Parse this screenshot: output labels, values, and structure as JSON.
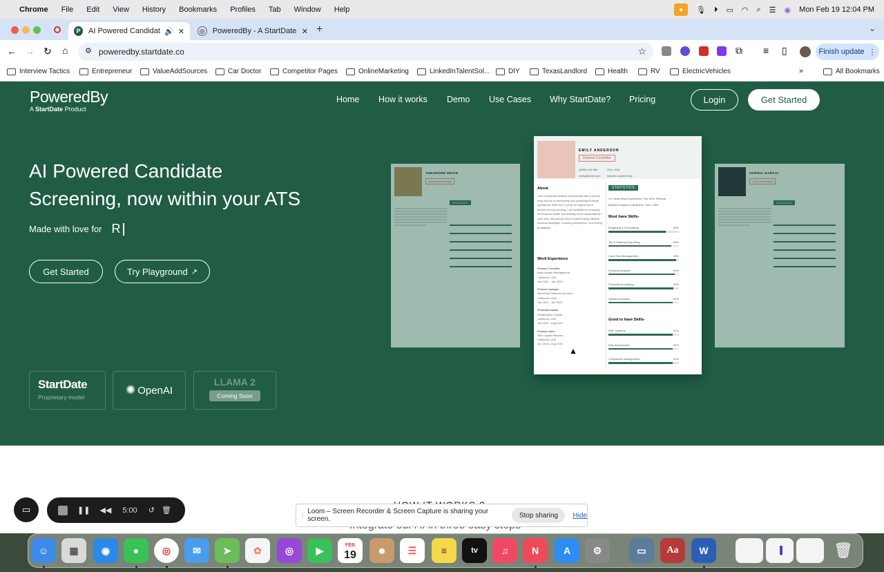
{
  "menubar": {
    "app": "Chrome",
    "items": [
      "File",
      "Edit",
      "View",
      "History",
      "Bookmarks",
      "Profiles",
      "Tab",
      "Window",
      "Help"
    ],
    "clock": "Mon Feb 19  12:04 PM"
  },
  "tabs": [
    {
      "title": "AI Powered Candidate Sc",
      "active": true
    },
    {
      "title": "PoweredBy - A StartDate Pro",
      "active": false
    }
  ],
  "toolbar": {
    "url": "poweredby.startdate.co",
    "finish_update": "Finish update"
  },
  "bookmarks": [
    "Interview Tactics",
    "Entrepreneur",
    "ValueAddSources",
    "Car Doctor",
    "Competitor Pages",
    "OnlineMarketing",
    "LinkedInTalentSol...",
    "DIY",
    "TexasLandlord",
    "Health",
    "RV",
    "ElectricVehicles"
  ],
  "all_bookmarks": "All Bookmarks",
  "site": {
    "logo": "PoweredBy",
    "logo_sub_prefix": "A",
    "logo_sub_brand": "StartDate",
    "logo_sub_suffix": "Product",
    "nav": [
      "Home",
      "How it works",
      "Demo",
      "Use Cases",
      "Why StartDate?",
      "Pricing"
    ],
    "login": "Login",
    "get_started_nav": "Get Started",
    "headline_1": "AI Powered Candidate",
    "headline_2": "Screening, now within your ATS",
    "tagline": "Made with love for",
    "typing": "R",
    "cta_primary": "Get Started",
    "cta_secondary": "Try Playground",
    "logos": {
      "startdate": "StartDate",
      "startdate_sub": "Proprietary model",
      "openai": "OpenAI",
      "llama": "LLAMA 2",
      "coming_soon": "Coming Soon"
    },
    "below_heading": "HOW IT WORKS ?",
    "below_sub": "Integrate our AI in three easy steps"
  },
  "resume_center": {
    "name": "EMILY ANDERSON",
    "role": "Finance Controller",
    "phone": "(5896) 444 555",
    "location": "Ohio, USA",
    "email": "emily@email.com",
    "linkedin": "linkedin.com/in/emily",
    "about_title": "About",
    "about_text": "I am a seasoned finance professional with a proven track record of overseeing and optimizing financial operations. With over 4 years of experience in finance and accounting, I am dedicated to ensuring the financial health and stability of the organizations I work with. My passion lies in implementing efficient financial strategies, ensuring compliance, and driving profitability.",
    "work_title": "Work Experience",
    "jobs": [
      {
        "title": "Finance Controller",
        "company": "Apex Wealth Management",
        "place": "California, USA",
        "dates": "Jan 2022 - Jan 2023"
      },
      {
        "title": "Finance manager",
        "company": "SilverOak Financial Services",
        "place": "California, USA",
        "dates": "Jan 2021 - Jan 2022"
      },
      {
        "title": "Financial Analyst",
        "company": "WealthWave Capital",
        "place": "California, USA",
        "dates": "Jan 2020 - Aug 2021"
      },
      {
        "title": "Finance Intern",
        "company": "Elite Capital Partners",
        "place": "California, USA",
        "dates": "Jun 2019 - Aug 2019"
      }
    ],
    "stats_title": "STATISTICS",
    "stats": [
      "2-5 Years Work Experience",
      "Full Time",
      "Remote",
      "Master's Degree in Business",
      "Ohio, USA"
    ],
    "must_title": "Must have Skills-",
    "must": [
      {
        "label": "Budgeting & Forecasting",
        "pct": "81%",
        "value": 0.81
      },
      {
        "label": "Tax & Statutory Reporting",
        "pct": "89%",
        "value": 0.89
      },
      {
        "label": "Cash Flow Management",
        "pct": "96%",
        "value": 0.96
      },
      {
        "label": "Financial Analysis",
        "pct": "94%",
        "value": 0.94
      },
      {
        "label": "Financial Accounting",
        "pct": "92%",
        "value": 0.92
      },
      {
        "label": "Variance Analysis",
        "pct": "91%",
        "value": 0.91
      }
    ],
    "good_title": "Good to have Skills-",
    "good": [
      {
        "label": "ERP Systems",
        "pct": "91%",
        "value": 0.91
      },
      {
        "label": "Risk Assessment",
        "pct": "91%",
        "value": 0.91
      },
      {
        "label": "Compliance Management",
        "pct": "91%",
        "value": 0.91
      }
    ]
  },
  "resume_left": {
    "name": "THEODORE DEVIN",
    "role": "Marketing Manager",
    "stats_title": "STATISTICS"
  },
  "resume_right": {
    "name": "SOPHIA GARCIA",
    "role": "Chief Accountant",
    "stats_title": "STATISTICS"
  },
  "loom": {
    "timer": "5:00",
    "banner_text": "Loom – Screen Recorder & Screen Capture is sharing your screen.",
    "stop": "Stop sharing",
    "hide": "Hide"
  },
  "dock_calendar": {
    "month": "FEB",
    "day": "19"
  },
  "colors": {
    "brand_green": "#205d44",
    "tab_strip": "#d6e3f6"
  }
}
